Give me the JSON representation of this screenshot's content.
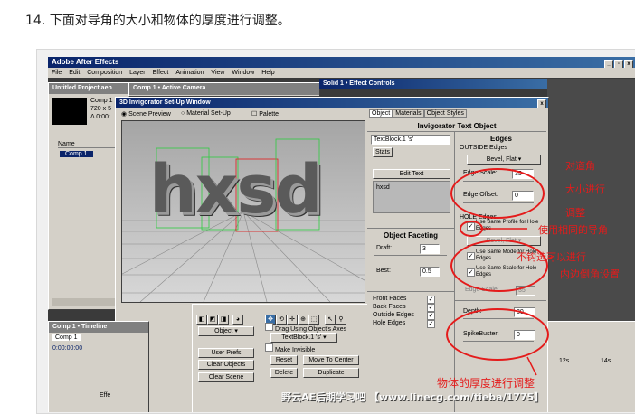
{
  "heading": "14. 下面对导角的大小和物体的厚度进行调整。",
  "app": {
    "title": "Adobe After Effects",
    "menus": [
      "File",
      "Edit",
      "Composition",
      "Layer",
      "Effect",
      "Animation",
      "View",
      "Window",
      "Help"
    ]
  },
  "project": {
    "title": "Untitled Project.aep",
    "info": [
      "Comp 1",
      "720 x 5",
      "Δ 0:00:"
    ],
    "col_name": "Name",
    "item": "Comp 1"
  },
  "comp_title": "Comp 1 • Active Camera",
  "effect_controls_title": "Solid 1 • Effect Controls",
  "inv": {
    "title": "3D Invigorator Set-Up Window",
    "radios": [
      "Scene Preview",
      "Material Set-Up",
      "Palette"
    ],
    "preview_text": "hxsd",
    "tabs": [
      "Object",
      "Materials",
      "Object Styles"
    ],
    "object_title": "Invigorator Text Object",
    "text_value": "TextBlock.1 's'",
    "stats": "Stats",
    "edit_text": "Edit Text",
    "text_content": "hxsd",
    "faceting_title": "Object Faceting",
    "draft_label": "Draft:",
    "draft_value": "3",
    "best_label": "Best:",
    "best_value": "0.5",
    "face_labels": [
      "Front Faces",
      "Back Faces",
      "Outside Edges",
      "Hole Edges"
    ],
    "edges_title": "Edges",
    "outside_edges": "OUTSIDE Edges",
    "bevel": "Bevel, Flat",
    "edge_scale_label": "Edge Scale:",
    "edge_scale_value": "35",
    "edge_offset_label": "Edge Offset:",
    "edge_offset_value": "0",
    "hole_edges": "HOLE Edges",
    "same_profile": "Use Same Profile for Hole Edges",
    "hole_bevel": "Bevel, Flat",
    "same_mode": "Use Same Mode for Hole Edges",
    "same_scale": "Use Same Scale for Hole Edges",
    "hole_scale_label": "Edge Scale:",
    "hole_scale_value": "35",
    "depth_label": "Depth:",
    "depth_value": "30",
    "spike_label": "SpikeBuster:",
    "spike_value": "0"
  },
  "toolbox": {
    "object_dropdown": "Object",
    "drag_axes": "Drag Using Object's Axes",
    "textblock_dropdown": "TextBlock.1 's'",
    "make_invisible": "Make Invisible",
    "user_prefs": "User Prefs",
    "reset": "Reset",
    "move_to_center": "Move To Center",
    "clear_objects": "Clear Objects",
    "delete": "Delete",
    "duplicate": "Duplicate",
    "clear_scene": "Clear Scene"
  },
  "timeline": {
    "title": "Comp 1 • Timeline",
    "tab": "Comp 1",
    "time": "0:00:00:00",
    "row": "Effe",
    "markers": [
      "12s",
      "14s"
    ]
  },
  "annotations": {
    "a1": "对道角",
    "a2": "大小进行",
    "a3": "调整",
    "a4": "使用相同的导角",
    "a5": "不钩选可以进行",
    "a6": "内边倒角设置",
    "a7": "物体的厚度进行调整"
  },
  "watermark": "野云AE后期学习吧 【www.linecg.com/tieba/1775】",
  "colors": {
    "annotation": "#e41b1b",
    "titlebar": "#0a246a",
    "panel": "#d4d0c8"
  }
}
